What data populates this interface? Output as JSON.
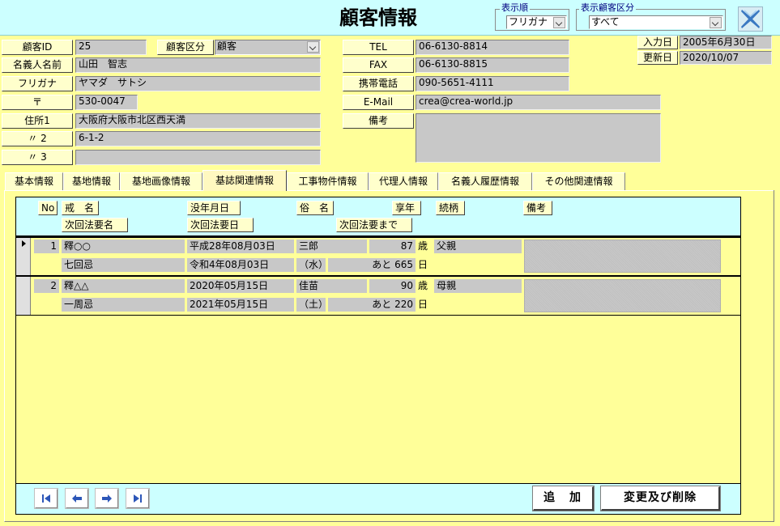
{
  "header": {
    "title": "顧客情報",
    "sort_group_label": "表示順",
    "sort_value": "フリガナ",
    "filter_group_label": "表示顧客区分",
    "filter_value": "すべて",
    "close_icon": "close-x-icon"
  },
  "customer": {
    "id_label": "顧客ID",
    "id_value": "25",
    "category_label": "顧客区分",
    "category_value": "顧客",
    "name_label": "名義人名前",
    "name_value": "山田　智志",
    "kana_label": "フリガナ",
    "kana_value": "ヤマダ　サトシ",
    "zip_label": "〒",
    "zip_value": "530-0047",
    "addr1_label": "住所1",
    "addr1_value": "大阪府大阪市北区西天満",
    "addr2_label": "〃 2",
    "addr2_value": "6-1-2",
    "addr3_label": "〃 3",
    "addr3_value": "",
    "tel_label": "TEL",
    "tel_value": "06-6130-8814",
    "fax_label": "FAX",
    "fax_value": "06-6130-8815",
    "mobile_label": "携帯電話",
    "mobile_value": "090-5651-4111",
    "email_label": "E-Mail",
    "email_value": "crea@crea-world.jp",
    "memo_label": "備考",
    "memo_value": "",
    "entry_date_label": "入力日",
    "entry_date_value": "2005年6月30日",
    "update_date_label": "更新日",
    "update_date_value": "2020/10/07"
  },
  "tabs": [
    {
      "label": "基本情報"
    },
    {
      "label": "基地情報"
    },
    {
      "label": "基地画像情報"
    },
    {
      "label": "基誌関連情報",
      "active": true
    },
    {
      "label": "工事物件情報"
    },
    {
      "label": "代理人情報"
    },
    {
      "label": "名義人履歴情報"
    },
    {
      "label": "その他関連情報"
    }
  ],
  "columns": {
    "no": "No",
    "kaimyo": "戒　名",
    "death_date": "没年月日",
    "zokumyo": "俗　名",
    "age": "享年",
    "relation": "続柄",
    "remark": "備考",
    "next_memorial_name": "次回法要名",
    "next_memorial_date": "次回法要日",
    "next_memorial_until": "次回法要まで"
  },
  "records": [
    {
      "no": "1",
      "kaimyo": "釋○○",
      "death_date": "平成28年08月03日",
      "zokumyo": "三郎",
      "age": "87",
      "age_unit": "歳",
      "relation": "父親",
      "memorial_name": "七回忌",
      "memorial_date": "令和4年08月03日",
      "weekday": "（水）",
      "until_prefix": "あと",
      "until_days": "665",
      "until_unit": "日"
    },
    {
      "no": "2",
      "kaimyo": "釋△△",
      "death_date": "2020年05月15日",
      "zokumyo": "佳苗",
      "age": "90",
      "age_unit": "歳",
      "relation": "母親",
      "memorial_name": "一周忌",
      "memorial_date": "2021年05月15日",
      "weekday": "（土）",
      "until_prefix": "あと",
      "until_days": "220",
      "until_unit": "日"
    }
  ],
  "footer": {
    "add_label": "追　加",
    "edit_delete_label": "変更及び削除"
  }
}
